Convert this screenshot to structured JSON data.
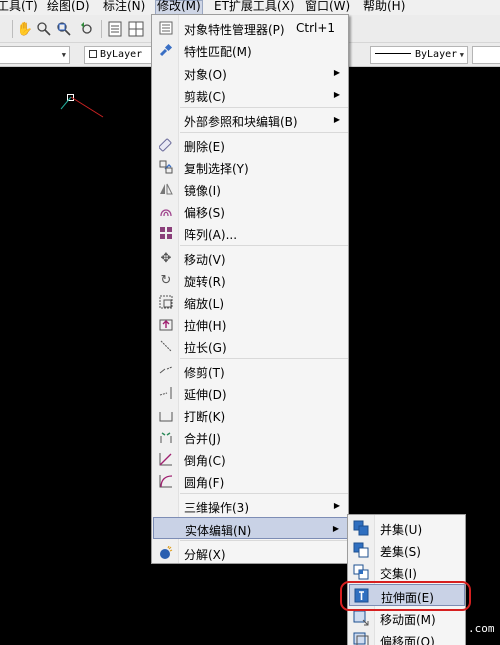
{
  "menubar": {
    "items": [
      {
        "label": "工具(T)"
      },
      {
        "label": "绘图(D)"
      },
      {
        "label": "标注(N)"
      },
      {
        "label": "修改(M)"
      },
      {
        "label": "ET扩展工具(X)"
      },
      {
        "label": "窗口(W)"
      },
      {
        "label": "帮助(H)"
      }
    ]
  },
  "properties_bar": {
    "color_value": "ByLayer",
    "linetype_value": "ByLayer"
  },
  "modify_menu": {
    "items": [
      {
        "label": "对象特性管理器(P)",
        "shortcut": "Ctrl+1"
      },
      {
        "label": "特性匹配(M)"
      },
      {
        "label": "对象(O)"
      },
      {
        "label": "剪裁(C)"
      },
      {
        "label": "外部参照和块编辑(B)"
      },
      {
        "label": "删除(E)"
      },
      {
        "label": "复制选择(Y)"
      },
      {
        "label": "镜像(I)"
      },
      {
        "label": "偏移(S)"
      },
      {
        "label": "阵列(A)..."
      },
      {
        "label": "移动(V)"
      },
      {
        "label": "旋转(R)"
      },
      {
        "label": "缩放(L)"
      },
      {
        "label": "拉伸(H)"
      },
      {
        "label": "拉长(G)"
      },
      {
        "label": "修剪(T)"
      },
      {
        "label": "延伸(D)"
      },
      {
        "label": "打断(K)"
      },
      {
        "label": "合并(J)"
      },
      {
        "label": "倒角(C)"
      },
      {
        "label": "圆角(F)"
      },
      {
        "label": "三维操作(3)"
      },
      {
        "label": "实体编辑(N)"
      },
      {
        "label": "分解(X)"
      }
    ]
  },
  "solid_edit_submenu": {
    "items": [
      {
        "label": "并集(U)"
      },
      {
        "label": "差集(S)"
      },
      {
        "label": "交集(I)"
      },
      {
        "label": "拉伸面(E)"
      },
      {
        "label": "移动面(M)"
      },
      {
        "label": "偏移面(O)"
      }
    ]
  },
  "watermark": ".com",
  "colors": {
    "highlight": "#c9d2e6",
    "annotation_ring": "#d62020",
    "canvas": "#000000"
  }
}
